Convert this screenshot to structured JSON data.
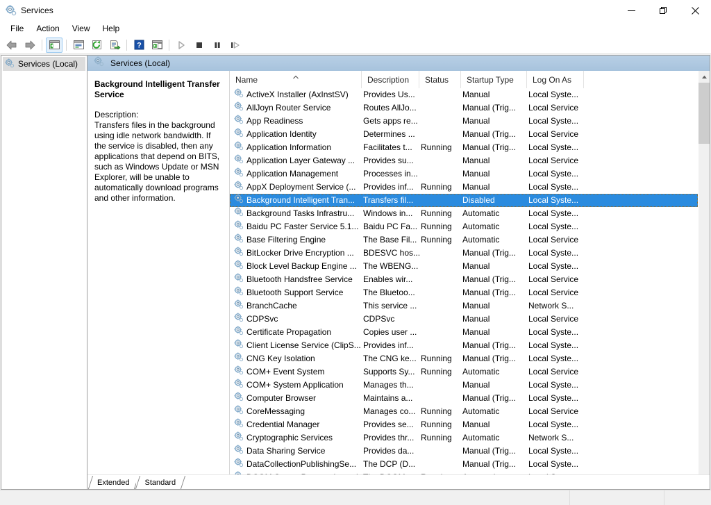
{
  "window": {
    "title": "Services",
    "icon": "services-gear-icon",
    "minimize_label": "Minimize",
    "restore_label": "Restore",
    "close_label": "Close"
  },
  "menu": {
    "items": [
      {
        "label": "File"
      },
      {
        "label": "Action"
      },
      {
        "label": "View"
      },
      {
        "label": "Help"
      }
    ]
  },
  "toolbar": {
    "buttons": [
      {
        "name": "back-icon",
        "label": "Back"
      },
      {
        "name": "forward-icon",
        "label": "Forward"
      },
      {
        "name": "show-hide-console-tree-icon",
        "label": "Show/Hide Console Tree"
      },
      {
        "name": "properties-icon",
        "label": "Properties"
      },
      {
        "name": "refresh-icon",
        "label": "Refresh"
      },
      {
        "name": "export-list-icon",
        "label": "Export List"
      },
      {
        "name": "help-icon",
        "label": "Help"
      },
      {
        "name": "show-action-pane-icon",
        "label": "Show/Hide Action Pane"
      },
      {
        "name": "start-service-icon",
        "label": "Start Service"
      },
      {
        "name": "stop-service-icon",
        "label": "Stop Service"
      },
      {
        "name": "pause-service-icon",
        "label": "Pause Service"
      },
      {
        "name": "restart-service-icon",
        "label": "Restart Service"
      }
    ]
  },
  "tree": {
    "root_label": "Services (Local)"
  },
  "pane": {
    "header_label": "Services (Local)"
  },
  "details": {
    "title": "Background Intelligent Transfer Service",
    "description_label": "Description:",
    "description_body": "Transfers files in the background using idle network bandwidth. If the service is disabled, then any applications that depend on BITS, such as Windows Update or MSN Explorer, will be unable to automatically download programs and other information."
  },
  "list": {
    "columns": [
      {
        "key": "name",
        "label": "Name",
        "sorted": "asc"
      },
      {
        "key": "description",
        "label": "Description"
      },
      {
        "key": "status",
        "label": "Status"
      },
      {
        "key": "startup",
        "label": "Startup Type"
      },
      {
        "key": "logon",
        "label": "Log On As"
      }
    ],
    "rows": [
      {
        "name": "ActiveX Installer (AxInstSV)",
        "description": "Provides Us...",
        "status": "",
        "startup": "Manual",
        "logon": "Local Syste...",
        "selected": false
      },
      {
        "name": "AllJoyn Router Service",
        "description": "Routes AllJo...",
        "status": "",
        "startup": "Manual (Trig...",
        "logon": "Local Service",
        "selected": false
      },
      {
        "name": "App Readiness",
        "description": "Gets apps re...",
        "status": "",
        "startup": "Manual",
        "logon": "Local Syste...",
        "selected": false
      },
      {
        "name": "Application Identity",
        "description": "Determines ...",
        "status": "",
        "startup": "Manual (Trig...",
        "logon": "Local Service",
        "selected": false
      },
      {
        "name": "Application Information",
        "description": "Facilitates t...",
        "status": "Running",
        "startup": "Manual (Trig...",
        "logon": "Local Syste...",
        "selected": false
      },
      {
        "name": "Application Layer Gateway ...",
        "description": "Provides su...",
        "status": "",
        "startup": "Manual",
        "logon": "Local Service",
        "selected": false
      },
      {
        "name": "Application Management",
        "description": "Processes in...",
        "status": "",
        "startup": "Manual",
        "logon": "Local Syste...",
        "selected": false
      },
      {
        "name": "AppX Deployment Service (...",
        "description": "Provides inf...",
        "status": "Running",
        "startup": "Manual",
        "logon": "Local Syste...",
        "selected": false
      },
      {
        "name": "Background Intelligent Tran...",
        "description": "Transfers fil...",
        "status": "",
        "startup": "Disabled",
        "logon": "Local Syste...",
        "selected": true
      },
      {
        "name": "Background Tasks Infrastru...",
        "description": "Windows in...",
        "status": "Running",
        "startup": "Automatic",
        "logon": "Local Syste...",
        "selected": false
      },
      {
        "name": "Baidu PC Faster Service 5.1...",
        "description": "Baidu PC Fa...",
        "status": "Running",
        "startup": "Automatic",
        "logon": "Local Syste...",
        "selected": false
      },
      {
        "name": "Base Filtering Engine",
        "description": "The Base Fil...",
        "status": "Running",
        "startup": "Automatic",
        "logon": "Local Service",
        "selected": false
      },
      {
        "name": "BitLocker Drive Encryption ...",
        "description": "BDESVC hos...",
        "status": "",
        "startup": "Manual (Trig...",
        "logon": "Local Syste...",
        "selected": false
      },
      {
        "name": "Block Level Backup Engine ...",
        "description": "The WBENG...",
        "status": "",
        "startup": "Manual",
        "logon": "Local Syste...",
        "selected": false
      },
      {
        "name": "Bluetooth Handsfree Service",
        "description": "Enables wir...",
        "status": "",
        "startup": "Manual (Trig...",
        "logon": "Local Service",
        "selected": false
      },
      {
        "name": "Bluetooth Support Service",
        "description": "The Bluetoo...",
        "status": "",
        "startup": "Manual (Trig...",
        "logon": "Local Service",
        "selected": false
      },
      {
        "name": "BranchCache",
        "description": "This service ...",
        "status": "",
        "startup": "Manual",
        "logon": "Network S...",
        "selected": false
      },
      {
        "name": "CDPSvc",
        "description": "CDPSvc",
        "status": "",
        "startup": "Manual",
        "logon": "Local Service",
        "selected": false
      },
      {
        "name": "Certificate Propagation",
        "description": "Copies user ...",
        "status": "",
        "startup": "Manual",
        "logon": "Local Syste...",
        "selected": false
      },
      {
        "name": "Client License Service (ClipS...",
        "description": "Provides inf...",
        "status": "",
        "startup": "Manual (Trig...",
        "logon": "Local Syste...",
        "selected": false
      },
      {
        "name": "CNG Key Isolation",
        "description": "The CNG ke...",
        "status": "Running",
        "startup": "Manual (Trig...",
        "logon": "Local Syste...",
        "selected": false
      },
      {
        "name": "COM+ Event System",
        "description": "Supports Sy...",
        "status": "Running",
        "startup": "Automatic",
        "logon": "Local Service",
        "selected": false
      },
      {
        "name": "COM+ System Application",
        "description": "Manages th...",
        "status": "",
        "startup": "Manual",
        "logon": "Local Syste...",
        "selected": false
      },
      {
        "name": "Computer Browser",
        "description": "Maintains a...",
        "status": "",
        "startup": "Manual (Trig...",
        "logon": "Local Syste...",
        "selected": false
      },
      {
        "name": "CoreMessaging",
        "description": "Manages co...",
        "status": "Running",
        "startup": "Automatic",
        "logon": "Local Service",
        "selected": false
      },
      {
        "name": "Credential Manager",
        "description": "Provides se...",
        "status": "Running",
        "startup": "Manual",
        "logon": "Local Syste...",
        "selected": false
      },
      {
        "name": "Cryptographic Services",
        "description": "Provides thr...",
        "status": "Running",
        "startup": "Automatic",
        "logon": "Network S...",
        "selected": false
      },
      {
        "name": "Data Sharing Service",
        "description": "Provides da...",
        "status": "",
        "startup": "Manual (Trig...",
        "logon": "Local Syste...",
        "selected": false
      },
      {
        "name": "DataCollectionPublishingSe...",
        "description": "The DCP (D...",
        "status": "",
        "startup": "Manual (Trig...",
        "logon": "Local Syste...",
        "selected": false
      },
      {
        "name": "DCOM Server Process Launch...",
        "description": "The DCOM...",
        "status": "Running",
        "startup": "Automatic",
        "logon": "Local Syst...",
        "selected": false
      }
    ]
  },
  "tabs": [
    {
      "label": "Extended",
      "active": false
    },
    {
      "label": "Standard",
      "active": true
    }
  ],
  "statusbar": {
    "text": ""
  },
  "colors": {
    "selection": "#2a8bdf",
    "pane_header_top": "#b8cfe5",
    "pane_header_bottom": "#a7c3dd",
    "window_chrome": "#f0f0f0",
    "tree_selection": "#dcdcdc"
  }
}
